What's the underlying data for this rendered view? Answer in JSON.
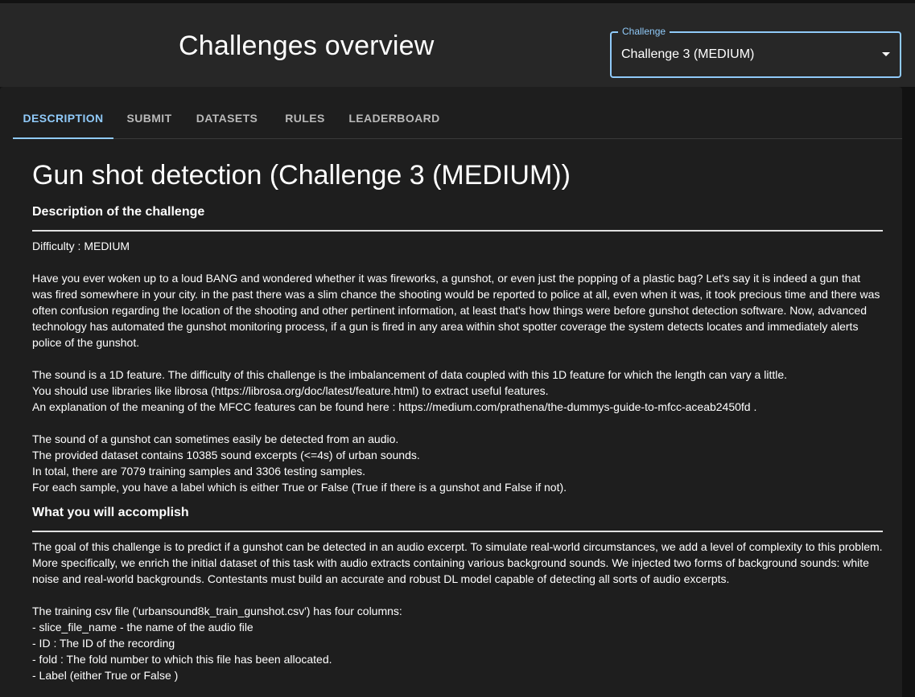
{
  "header": {
    "title": "Challenges overview",
    "challenge_select": {
      "label": "Challenge",
      "value": "Challenge 3 (MEDIUM)"
    }
  },
  "tabs": [
    {
      "label": "DESCRIPTION",
      "active": true
    },
    {
      "label": "SUBMIT",
      "active": false
    },
    {
      "label": "DATASETS",
      "active": false
    },
    {
      "label": "RULES",
      "active": false
    },
    {
      "label": "LEADERBOARD",
      "active": false
    }
  ],
  "content": {
    "title": "Gun shot detection (Challenge 3 (MEDIUM))",
    "description_heading": "Description of the challenge",
    "difficulty": "Difficulty : MEDIUM",
    "intro": "Have you ever woken up to a loud BANG and wondered whether it was fireworks, a gunshot, or even just the popping of a plastic bag? Let's say it is indeed a gun that was fired somewhere in your city. in the past there was a slim chance the shooting would be reported to police at all, even when it was, it took precious time and there was often confusion regarding the location of the shooting and other pertinent information, at least that's how things were before gunshot detection software. Now, advanced technology has automated the gunshot monitoring process, if a gun is fired in any area within shot spotter coverage the system detects locates and immediately alerts police of the gunshot.",
    "feature_lines": [
      "The sound is a 1D feature. The difficulty of this challenge is the imbalancement of data coupled with this 1D feature for which the length can vary a little.",
      "You should use libraries like librosa (https://librosa.org/doc/latest/feature.html) to extract useful features.",
      "An explanation of the meaning of the MFCC features can be found here : https://medium.com/prathena/the-dummys-guide-to-mfcc-aceab2450fd ."
    ],
    "dataset_lines": [
      "The sound of a gunshot can sometimes easily be detected from an audio.",
      "The provided dataset contains 10385 sound excerpts (<=4s) of urban sounds.",
      "In total, there are 7079 training samples and 3306 testing samples.",
      "For each sample, you have a label which is either True or False (True if there is a gunshot and False if not)."
    ],
    "accomplish_heading": "What you will accomplish",
    "goal": "The goal of this challenge is to predict if a gunshot can be detected in an audio excerpt. To simulate real-world circumstances, we add a level of complexity to this problem. More specifically, we enrich the initial dataset of this task with audio extracts containing various background sounds. We injected two forms of background sounds: white noise and real-world backgrounds. Contestants must build an accurate and robust DL model capable of detecting all sorts of audio excerpts.",
    "csv_lines": [
      "The training csv file ('urbansound8k_train_gunshot.csv') has four columns:",
      "- slice_file_name - the name of the audio file",
      "- ID : The ID of the recording",
      "- fold : The fold number to which this file has been allocated.",
      "- Label (either True or False )"
    ]
  },
  "colors": {
    "accent": "#90caf9",
    "header_bg": "#272727",
    "panel_bg": "#1e1e1e",
    "page_bg": "#121212"
  }
}
